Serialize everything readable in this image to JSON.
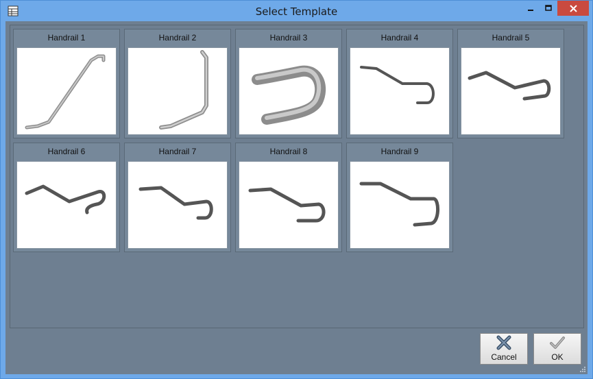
{
  "window": {
    "title": "Select Template",
    "app_icon": "form-icon",
    "controls": [
      "minimize-icon",
      "maximize-icon",
      "close-icon"
    ]
  },
  "templates": [
    {
      "label": "Handrail 1"
    },
    {
      "label": "Handrail 2"
    },
    {
      "label": "Handrail 3"
    },
    {
      "label": "Handrail 4"
    },
    {
      "label": "Handrail 5"
    },
    {
      "label": "Handrail 6"
    },
    {
      "label": "Handrail 7"
    },
    {
      "label": "Handrail 8"
    },
    {
      "label": "Handrail 9"
    }
  ],
  "buttons": {
    "cancel_label": "Cancel",
    "ok_label": "OK"
  },
  "colors": {
    "titlebar": "#6ea9e9",
    "client": "#6e7f91",
    "close_button": "#c94a3f"
  }
}
